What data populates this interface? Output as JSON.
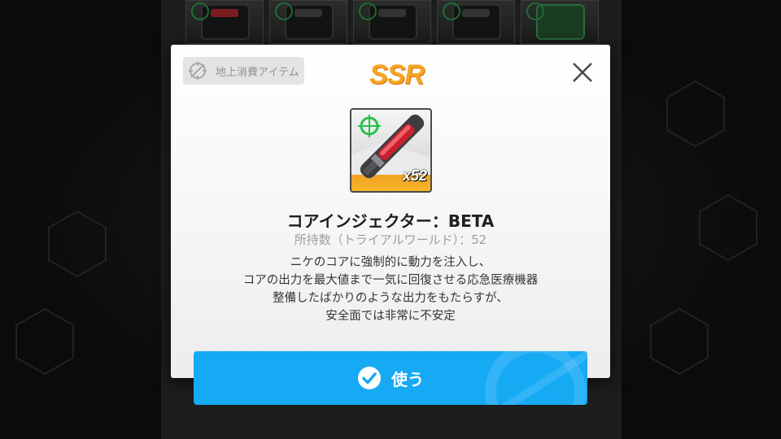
{
  "modal": {
    "category": {
      "label": "地上消費アイテム",
      "icon": "crosshair-slash-icon"
    },
    "rarity": "SSR",
    "close_icon": "close-icon",
    "item": {
      "icon": "core-injector-icon",
      "quantity": "x52",
      "name": "コアインジェクター：BETA",
      "owned": "所持数（トライアルワールド）：52",
      "description": [
        "ニケのコアに強制的に動力を注入し、",
        "コアの出力を最大値まで一気に回復させる応急医療機器",
        "整備したばかりのような出力をもたらすが、",
        "安全面では非常に不安定"
      ]
    },
    "use_button": {
      "label": "使う",
      "icon": "checkmark-icon"
    }
  },
  "colors": {
    "rarity": "#f5a522",
    "button": "#16aaf5",
    "modal_bg": "#ffffff",
    "backdrop": "#0b0c0c"
  }
}
